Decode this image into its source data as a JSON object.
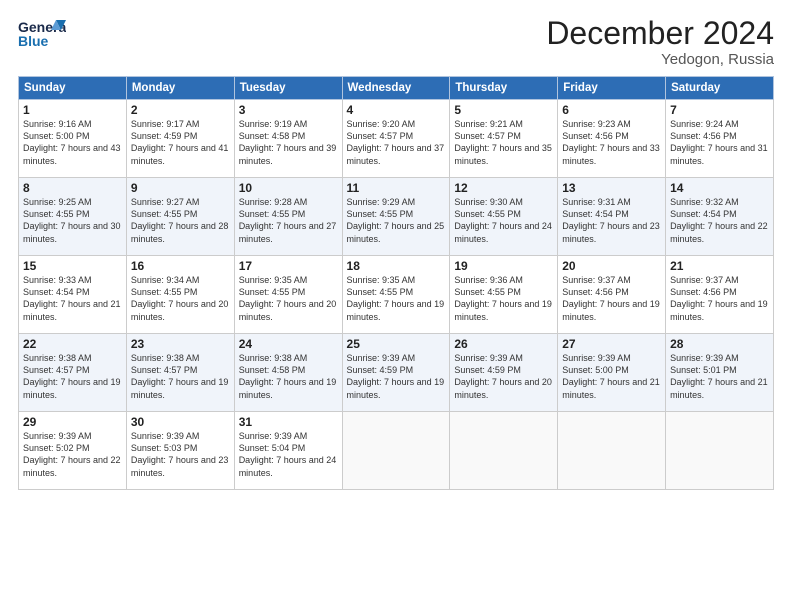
{
  "header": {
    "logo_general": "General",
    "logo_blue": "Blue",
    "month_title": "December 2024",
    "location": "Yedogon, Russia"
  },
  "days_of_week": [
    "Sunday",
    "Monday",
    "Tuesday",
    "Wednesday",
    "Thursday",
    "Friday",
    "Saturday"
  ],
  "weeks": [
    [
      {
        "day": "1",
        "rise": "Sunrise: 9:16 AM",
        "set": "Sunset: 5:00 PM",
        "daylight": "Daylight: 7 hours and 43 minutes."
      },
      {
        "day": "2",
        "rise": "Sunrise: 9:17 AM",
        "set": "Sunset: 4:59 PM",
        "daylight": "Daylight: 7 hours and 41 minutes."
      },
      {
        "day": "3",
        "rise": "Sunrise: 9:19 AM",
        "set": "Sunset: 4:58 PM",
        "daylight": "Daylight: 7 hours and 39 minutes."
      },
      {
        "day": "4",
        "rise": "Sunrise: 9:20 AM",
        "set": "Sunset: 4:57 PM",
        "daylight": "Daylight: 7 hours and 37 minutes."
      },
      {
        "day": "5",
        "rise": "Sunrise: 9:21 AM",
        "set": "Sunset: 4:57 PM",
        "daylight": "Daylight: 7 hours and 35 minutes."
      },
      {
        "day": "6",
        "rise": "Sunrise: 9:23 AM",
        "set": "Sunset: 4:56 PM",
        "daylight": "Daylight: 7 hours and 33 minutes."
      },
      {
        "day": "7",
        "rise": "Sunrise: 9:24 AM",
        "set": "Sunset: 4:56 PM",
        "daylight": "Daylight: 7 hours and 31 minutes."
      }
    ],
    [
      {
        "day": "8",
        "rise": "Sunrise: 9:25 AM",
        "set": "Sunset: 4:55 PM",
        "daylight": "Daylight: 7 hours and 30 minutes."
      },
      {
        "day": "9",
        "rise": "Sunrise: 9:27 AM",
        "set": "Sunset: 4:55 PM",
        "daylight": "Daylight: 7 hours and 28 minutes."
      },
      {
        "day": "10",
        "rise": "Sunrise: 9:28 AM",
        "set": "Sunset: 4:55 PM",
        "daylight": "Daylight: 7 hours and 27 minutes."
      },
      {
        "day": "11",
        "rise": "Sunrise: 9:29 AM",
        "set": "Sunset: 4:55 PM",
        "daylight": "Daylight: 7 hours and 25 minutes."
      },
      {
        "day": "12",
        "rise": "Sunrise: 9:30 AM",
        "set": "Sunset: 4:55 PM",
        "daylight": "Daylight: 7 hours and 24 minutes."
      },
      {
        "day": "13",
        "rise": "Sunrise: 9:31 AM",
        "set": "Sunset: 4:54 PM",
        "daylight": "Daylight: 7 hours and 23 minutes."
      },
      {
        "day": "14",
        "rise": "Sunrise: 9:32 AM",
        "set": "Sunset: 4:54 PM",
        "daylight": "Daylight: 7 hours and 22 minutes."
      }
    ],
    [
      {
        "day": "15",
        "rise": "Sunrise: 9:33 AM",
        "set": "Sunset: 4:54 PM",
        "daylight": "Daylight: 7 hours and 21 minutes."
      },
      {
        "day": "16",
        "rise": "Sunrise: 9:34 AM",
        "set": "Sunset: 4:55 PM",
        "daylight": "Daylight: 7 hours and 20 minutes."
      },
      {
        "day": "17",
        "rise": "Sunrise: 9:35 AM",
        "set": "Sunset: 4:55 PM",
        "daylight": "Daylight: 7 hours and 20 minutes."
      },
      {
        "day": "18",
        "rise": "Sunrise: 9:35 AM",
        "set": "Sunset: 4:55 PM",
        "daylight": "Daylight: 7 hours and 19 minutes."
      },
      {
        "day": "19",
        "rise": "Sunrise: 9:36 AM",
        "set": "Sunset: 4:55 PM",
        "daylight": "Daylight: 7 hours and 19 minutes."
      },
      {
        "day": "20",
        "rise": "Sunrise: 9:37 AM",
        "set": "Sunset: 4:56 PM",
        "daylight": "Daylight: 7 hours and 19 minutes."
      },
      {
        "day": "21",
        "rise": "Sunrise: 9:37 AM",
        "set": "Sunset: 4:56 PM",
        "daylight": "Daylight: 7 hours and 19 minutes."
      }
    ],
    [
      {
        "day": "22",
        "rise": "Sunrise: 9:38 AM",
        "set": "Sunset: 4:57 PM",
        "daylight": "Daylight: 7 hours and 19 minutes."
      },
      {
        "day": "23",
        "rise": "Sunrise: 9:38 AM",
        "set": "Sunset: 4:57 PM",
        "daylight": "Daylight: 7 hours and 19 minutes."
      },
      {
        "day": "24",
        "rise": "Sunrise: 9:38 AM",
        "set": "Sunset: 4:58 PM",
        "daylight": "Daylight: 7 hours and 19 minutes."
      },
      {
        "day": "25",
        "rise": "Sunrise: 9:39 AM",
        "set": "Sunset: 4:59 PM",
        "daylight": "Daylight: 7 hours and 19 minutes."
      },
      {
        "day": "26",
        "rise": "Sunrise: 9:39 AM",
        "set": "Sunset: 4:59 PM",
        "daylight": "Daylight: 7 hours and 20 minutes."
      },
      {
        "day": "27",
        "rise": "Sunrise: 9:39 AM",
        "set": "Sunset: 5:00 PM",
        "daylight": "Daylight: 7 hours and 21 minutes."
      },
      {
        "day": "28",
        "rise": "Sunrise: 9:39 AM",
        "set": "Sunset: 5:01 PM",
        "daylight": "Daylight: 7 hours and 21 minutes."
      }
    ],
    [
      {
        "day": "29",
        "rise": "Sunrise: 9:39 AM",
        "set": "Sunset: 5:02 PM",
        "daylight": "Daylight: 7 hours and 22 minutes."
      },
      {
        "day": "30",
        "rise": "Sunrise: 9:39 AM",
        "set": "Sunset: 5:03 PM",
        "daylight": "Daylight: 7 hours and 23 minutes."
      },
      {
        "day": "31",
        "rise": "Sunrise: 9:39 AM",
        "set": "Sunset: 5:04 PM",
        "daylight": "Daylight: 7 hours and 24 minutes."
      },
      null,
      null,
      null,
      null
    ]
  ]
}
